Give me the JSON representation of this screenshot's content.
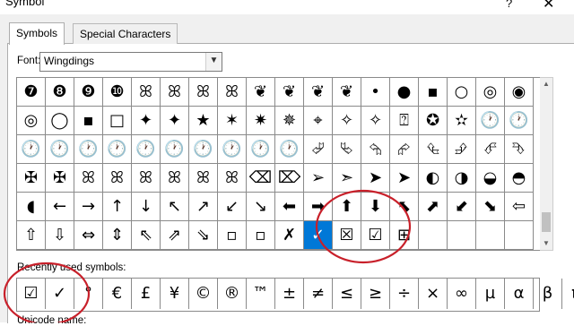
{
  "window": {
    "title": "Symbol",
    "help_glyph": "?",
    "close_glyph": "✕"
  },
  "tabs": [
    {
      "label": "Symbols"
    },
    {
      "label": "Special Characters"
    }
  ],
  "font": {
    "label": "Font:",
    "value": "Wingdings",
    "dropdown_icon": "chevron-down-icon"
  },
  "grid": {
    "rows": [
      [
        "❼",
        "❽",
        "❾",
        "❿",
        "ꕤ",
        "ꕤ",
        "ꕤ",
        "ꕤ",
        "❦",
        "❦",
        "❦",
        "❦",
        "•",
        "●",
        "▪",
        "○",
        "◎",
        "◉"
      ],
      [
        "◎",
        "◯",
        "▪",
        "□",
        "✦",
        "✦",
        "★",
        "✶",
        "✷",
        "✵",
        "⌖",
        "✧",
        "✧",
        "⍰",
        "✪",
        "✫",
        "🕐",
        "🕐"
      ],
      [
        "🕐",
        "🕐",
        "🕐",
        "🕐",
        "🕐",
        "🕐",
        "🕐",
        "🕐",
        "🕐",
        "🕐",
        "⮰",
        "⮱",
        "⮲",
        "⮳",
        "⮴",
        "⮵",
        "⮶",
        "⮷"
      ],
      [
        "✠",
        "✠",
        "ꕤ",
        "ꕤ",
        "ꕤ",
        "ꕤ",
        "ꕤ",
        "ꕤ",
        "⌫",
        "⌦",
        "➢",
        "➣",
        "➤",
        "➤",
        "◐",
        "◑",
        "◒",
        "◓"
      ],
      [
        "◖",
        "←",
        "→",
        "↑",
        "↓",
        "↖",
        "↗",
        "↙",
        "↘",
        "⬅",
        "➡",
        "⬆",
        "⬇",
        "⬉",
        "⬈",
        "⬋",
        "⬊",
        "⇦"
      ],
      [
        "⇧",
        "⇩",
        "⇔",
        "⇕",
        "⇖",
        "⇗",
        "⇘",
        "▫",
        "▫",
        "✗",
        "✓",
        "☒",
        "☑",
        "⊞",
        "",
        "",
        "",
        ""
      ]
    ],
    "selected": {
      "row": 5,
      "col": 10
    }
  },
  "recent": {
    "label": "Recently used symbols:",
    "items": [
      "☑",
      "✓",
      "°",
      "€",
      "£",
      "¥",
      "©",
      "®",
      "™",
      "±",
      "≠",
      "≤",
      "≥",
      "÷",
      "×",
      "∞",
      "µ",
      "α",
      "β",
      "π"
    ]
  },
  "unicode_label": "Unicode name:",
  "annotations": {
    "circle_color": "#c8202a"
  }
}
